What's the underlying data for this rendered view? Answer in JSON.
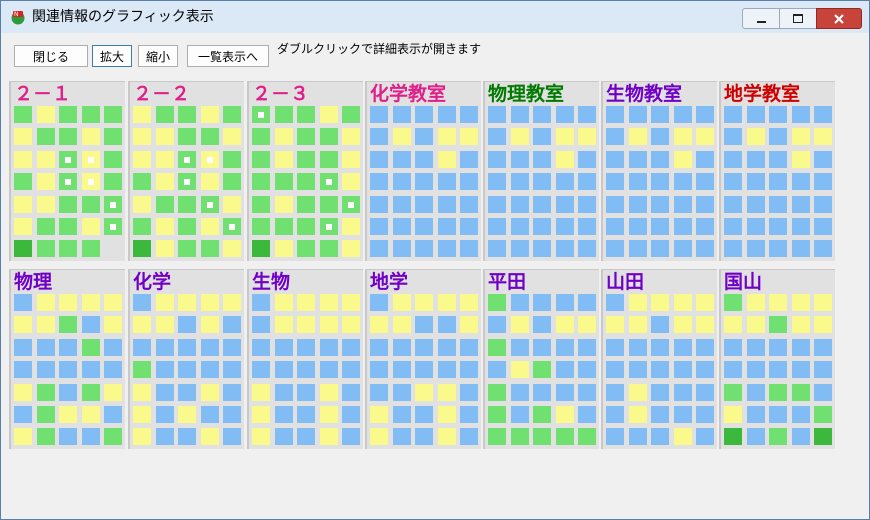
{
  "window": {
    "title": "関連情報のグラフィック表示",
    "controls": {
      "minimize": "minimize-icon",
      "maximize": "maximize-icon",
      "close": "close-icon"
    }
  },
  "toolbar": {
    "close_label": "閉じる",
    "zoom_in_label": "拡大",
    "zoom_out_label": "縮小",
    "list_view_label": "一覧表示へ",
    "hint": "ダブルクリックで詳細表示が開きます"
  },
  "colors": {
    "green": "#70e070",
    "darkgreen": "#3cb83c",
    "yellow": "#fafa8c",
    "blue": "#82bcf5",
    "title_magenta": "#e0208a",
    "title_green": "#007a00",
    "title_purple": "#7000c8",
    "title_red": "#d00000",
    "panel_bg": "#e1e1e1"
  },
  "legend_codes": {
    "g": "green",
    "G": "darkgreen",
    "y": "yellow",
    "b": "blue",
    "w": "green + white marker",
    "v": "yellow + white marker"
  },
  "rows": [
    {
      "panels": [
        {
          "title": "２－１",
          "title_color": "#e0208a",
          "cells": [
            "gyggg",
            "yggyg",
            "yywvg",
            "gywvg",
            "yyggw",
            "yggyw",
            "Gggg"
          ]
        },
        {
          "title": "２－２",
          "title_color": "#e0208a",
          "cells": [
            "yggyg",
            "yyggy",
            "yywvg",
            "gywyg",
            "yggwy",
            "gygyw",
            "Gyggy"
          ]
        },
        {
          "title": "２－３",
          "title_color": "#e0208a",
          "cells": [
            "wggyg",
            "gyggy",
            "gyggy",
            "gggwy",
            "gyggw",
            "gggwy",
            "Gyggy"
          ]
        },
        {
          "title": "化学教室",
          "title_color": "#e0208a",
          "cells": [
            "bbbbb",
            "bybyy",
            "bbbyb",
            "bbbbb",
            "bbbbb",
            "bbbbb",
            "bbbbb"
          ]
        },
        {
          "title": "物理教室",
          "title_color": "#007a00",
          "cells": [
            "bbbbb",
            "bybyy",
            "bbbyb",
            "bbbbb",
            "bbbbb",
            "bbbbb",
            "bbbbb"
          ]
        },
        {
          "title": "生物教室",
          "title_color": "#7000c8",
          "cells": [
            "bbbbb",
            "bybyy",
            "bbbyb",
            "bbbbb",
            "bbbbb",
            "bbbbb",
            "bbbbb"
          ]
        },
        {
          "title": "地学教室",
          "title_color": "#d00000",
          "cells": [
            "bbbbb",
            "bybyy",
            "bbbyb",
            "bbbbb",
            "bbbbb",
            "bbbbb",
            "bbbbb"
          ]
        }
      ]
    },
    {
      "panels": [
        {
          "title": "物理",
          "title_color": "#7000c8",
          "cells": [
            "byyyy",
            "yygby",
            "bbbgb",
            "bbbbb",
            "ygbgy",
            "bgyyb",
            "ygbbg"
          ]
        },
        {
          "title": "化学",
          "title_color": "#7000c8",
          "cells": [
            "byyyy",
            "yybyb",
            "bbbbb",
            "gbbbb",
            "ybbyb",
            "ybybb",
            "ybbyb"
          ]
        },
        {
          "title": "生物",
          "title_color": "#7000c8",
          "cells": [
            "byyyy",
            "byyyy",
            "bbbbb",
            "bbbbb",
            "ybbyb",
            "ybbyb",
            "ybbyb"
          ]
        },
        {
          "title": "地学",
          "title_color": "#7000c8",
          "cells": [
            "byyyy",
            "yybby",
            "bbbbb",
            "bbbbb",
            "bbyyb",
            "ybbyb",
            "ybbyb"
          ]
        },
        {
          "title": "平田",
          "title_color": "#7000c8",
          "cells": [
            "gbbbb",
            "bybyy",
            "gbbbb",
            "bygbb",
            "gbbbb",
            "gbgyb",
            "ggggg"
          ]
        },
        {
          "title": "山田",
          "title_color": "#7000c8",
          "cells": [
            "byyyy",
            "yybyy",
            "bbbbb",
            "bbbbb",
            "bybbb",
            "bybbb",
            "bbbyb"
          ]
        },
        {
          "title": "国山",
          "title_color": "#7000c8",
          "cells": [
            "gyyyy",
            "yygyy",
            "bbbbb",
            "bbbbb",
            "gbggb",
            "ybbbg",
            "GbgbG"
          ]
        }
      ]
    }
  ]
}
